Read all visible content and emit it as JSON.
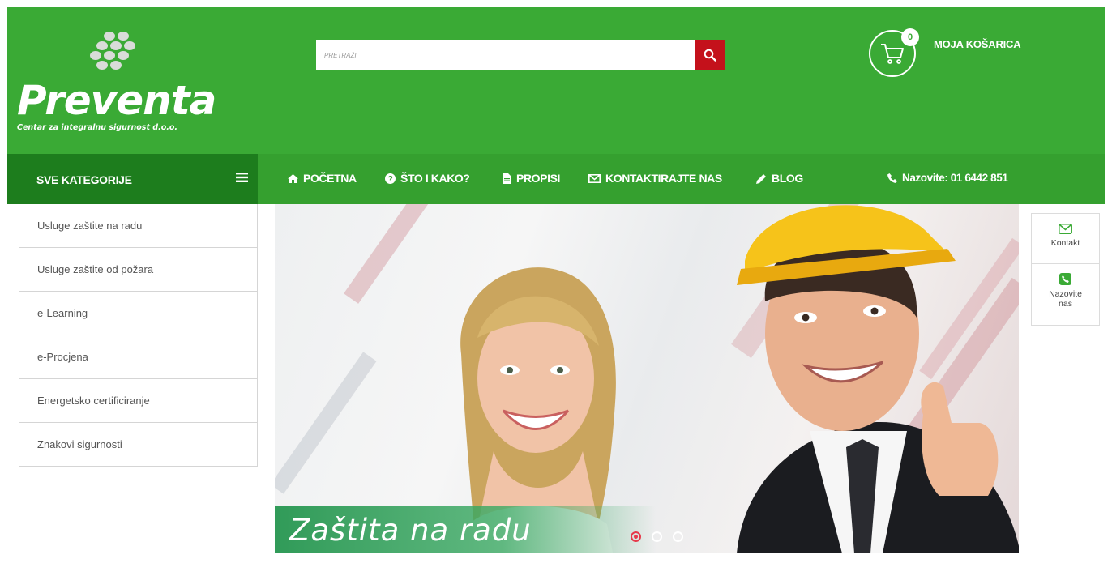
{
  "brand": {
    "name": "Preventa",
    "tagline": "Centar za integralnu sigurnost d.o.o."
  },
  "search": {
    "placeholder": "PRETRAŽI",
    "button_icon": "search-icon"
  },
  "cart": {
    "count": "0",
    "label": "MOJA KOŠARICA",
    "icon": "cart-icon"
  },
  "nav": {
    "categories_label": "SVE KATEGORIJE",
    "items": [
      {
        "label": "POČETNA",
        "icon": "home-icon"
      },
      {
        "label": "ŠTO I KAKO?",
        "icon": "question-icon"
      },
      {
        "label": "PROPISI",
        "icon": "document-icon"
      },
      {
        "label": "KONTAKTIRAJTE NAS",
        "icon": "envelope-icon"
      },
      {
        "label": "BLOG",
        "icon": "pencil-icon"
      }
    ],
    "phone": "Nazovite: 01 6442 851"
  },
  "sidebar": {
    "items": [
      {
        "label": "Usluge zaštite na radu"
      },
      {
        "label": "Usluge zaštite od požara"
      },
      {
        "label": "e-Learning"
      },
      {
        "label": "e-Procjena"
      },
      {
        "label": "Energetsko certificiranje"
      },
      {
        "label": "Znakovi sigurnosti"
      }
    ]
  },
  "hero": {
    "caption": "Zaštita na radu",
    "slides": 3,
    "active_slide": 1
  },
  "widget": {
    "contact_label": "Kontakt",
    "call_label_1": "Nazovite",
    "call_label_2": "nas"
  },
  "colors": {
    "primary": "#3aaa35",
    "dark": "#1d7d1d",
    "accent": "#c4111b"
  }
}
